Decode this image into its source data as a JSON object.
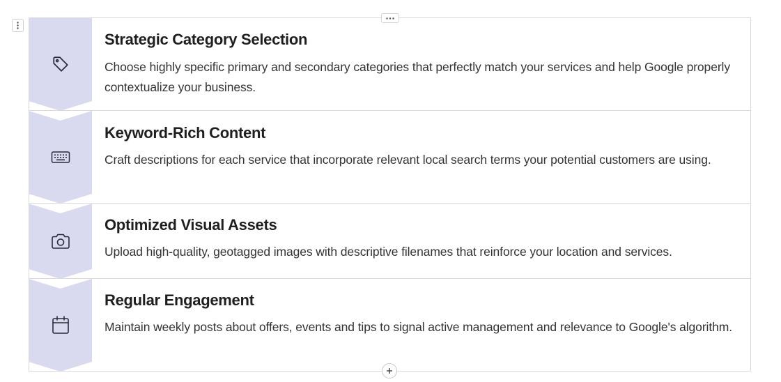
{
  "toolbar": {
    "drag_handle_icon": "vertical-dots-icon",
    "more_options_icon": "horizontal-dots-icon",
    "add_block_icon": "plus-icon"
  },
  "steps": [
    {
      "icon": "tag-icon",
      "title": "Strategic Category Selection",
      "description": "Choose highly specific primary and secondary categories that perfectly match your services and help Google properly contextualize your business."
    },
    {
      "icon": "keyboard-icon",
      "title": "Keyword-Rich Content",
      "description": "Craft descriptions for each service that incorporate relevant local search terms your potential customers are using."
    },
    {
      "icon": "camera-icon",
      "title": "Optimized Visual Assets",
      "description": "Upload high-quality, geotagged images with descriptive filenames that reinforce your location and services."
    },
    {
      "icon": "calendar-icon",
      "title": "Regular Engagement",
      "description": "Maintain weekly posts about offers, events and tips to signal active management and relevance to Google's algorithm."
    }
  ],
  "colors": {
    "chevron_fill": "#d9d9ef",
    "icon_stroke": "#2a2a3a",
    "border": "#d9d9d9",
    "title_text": "#1f1f1f",
    "body_text": "#333333"
  }
}
